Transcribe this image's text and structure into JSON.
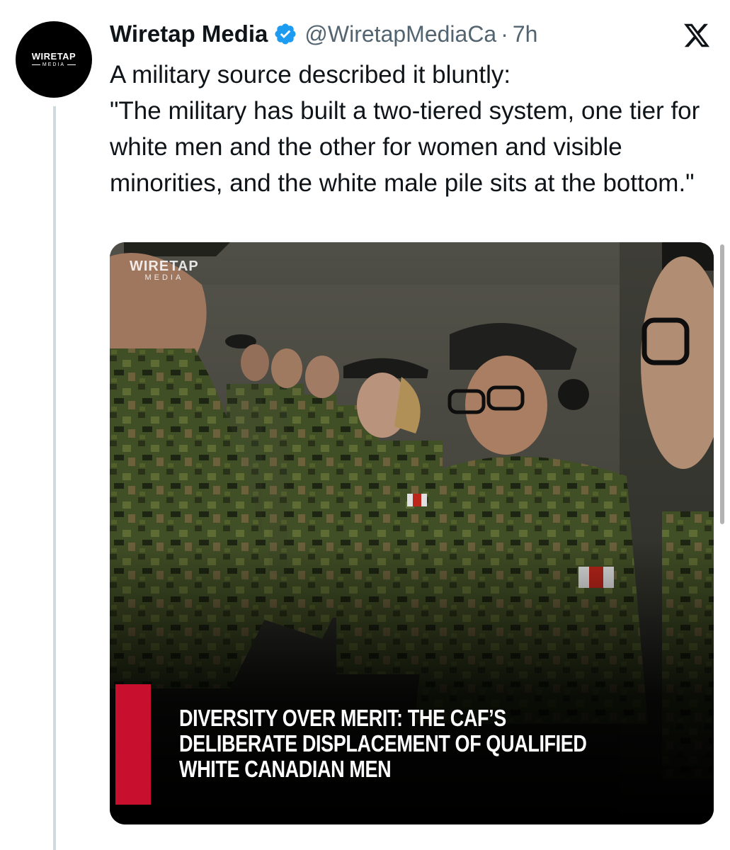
{
  "tweet": {
    "author": {
      "display_name": "Wiretap Media",
      "handle": "@WiretapMediaCa",
      "verified": true,
      "avatar": {
        "brand": "WIRETAP",
        "sub": "MEDIA"
      }
    },
    "separator": "·",
    "time": "7h",
    "text": "A military source described it bluntly:\n\"The military has built a two-tiered system, one tier for white men and the other for women and visible minorities, and the white male pile sits at the bottom.\"",
    "media": {
      "watermark_brand": "WIRETAP",
      "watermark_sub": "MEDIA",
      "headline": "DIVERSITY OVER MERIT: THE CAF’S\nDELIBERATE DISPLACEMENT OF QUALIFIED\nWHITE CANADIAN MEN"
    }
  },
  "icons": {
    "verified": "verified-badge-icon",
    "platform": "x-logo-icon"
  },
  "colors": {
    "text": "#0f1419",
    "secondary_text": "#536471",
    "verified_blue": "#1d9bf0",
    "thread_line": "#cfd9de",
    "headline_accent": "#c8102e"
  }
}
